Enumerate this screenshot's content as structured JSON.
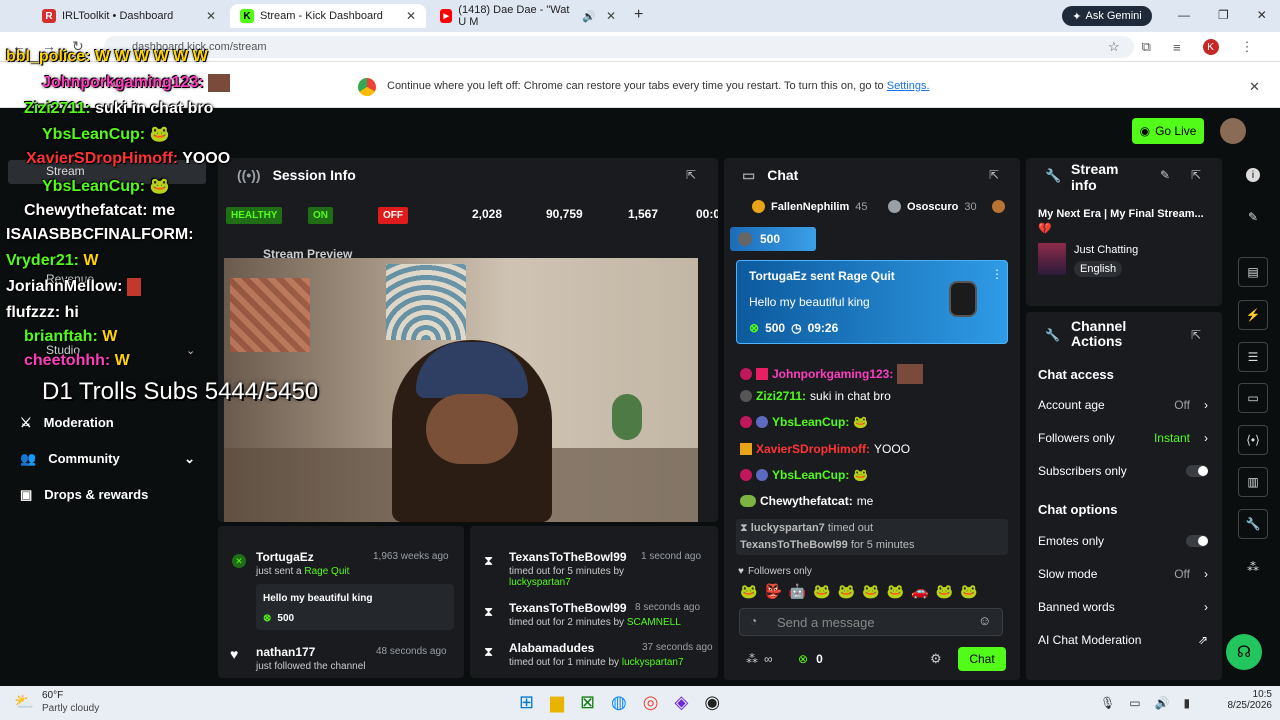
{
  "browser": {
    "tabs": [
      {
        "title": "IRLToolkit • Dashboard",
        "favicon": "R",
        "color": "#d42e2e"
      },
      {
        "title": "Stream - Kick Dashboard",
        "favicon": "K",
        "color": "#53fc18"
      },
      {
        "title": "(1418) Dae Dae - \"Wat U M",
        "favicon": "▶",
        "color": "#ff0000"
      }
    ],
    "ask_gemini": "Ask Gemini",
    "url": "dashboard.kick.com/stream",
    "restore_text": "Continue where you left off: Chrome can restore your tabs every time you restart. To turn this on, go to",
    "restore_link": "Settings."
  },
  "header": {
    "go_live": "Go Live"
  },
  "overlay": {
    "chat": [
      {
        "user": "bbl_police:",
        "msg": "W W W W W W",
        "color": "#ffd400"
      },
      {
        "user": "Johnporkgaming123:",
        "msg": "",
        "color": "#ff3ebf"
      },
      {
        "user": "Zizi2711:",
        "msg": "suki in chat bro",
        "color": "#53fc18"
      },
      {
        "user": "YbsLeanCup:",
        "msg": "",
        "color": "#53fc18"
      },
      {
        "user": "XavierSDropHimoff:",
        "msg": "YOOO",
        "color": "#ff3333"
      },
      {
        "user": "YbsLeanCup:",
        "msg": "",
        "color": "#53fc18"
      },
      {
        "user": "Chewythefatcat:",
        "msg": "me",
        "color": "#ffffff"
      },
      {
        "user": "ISAIASBBCFINALFORM:",
        "msg": "",
        "color": "#ffffff"
      },
      {
        "user": "Vryder21:",
        "msg": "W",
        "color": "#53fc18"
      },
      {
        "user": "JoriahnMellow:",
        "msg": "",
        "color": "#ffffff"
      },
      {
        "user": "flufzzz:",
        "msg": "hi",
        "color": "#ffffff"
      },
      {
        "user": "brianftah:",
        "msg": "W",
        "color": "#53fc18"
      },
      {
        "user": "cheetohhh:",
        "msg": "W",
        "color": "#ff3ebf"
      }
    ],
    "subs_goal": "D1 Trolls Subs 5444/5450"
  },
  "sidebar": {
    "items": [
      {
        "label": "Stream"
      },
      {
        "label": "Revenue"
      },
      {
        "label": "Studio"
      },
      {
        "label": "Moderation"
      },
      {
        "label": "Community"
      },
      {
        "label": "Drops & rewards"
      }
    ]
  },
  "session": {
    "title": "Session Info",
    "health": "HEALTHY",
    "on": "ON",
    "off": "OFF",
    "stats": [
      "2,028",
      "90,759",
      "1,567",
      "00:0"
    ],
    "preview_title": "Stream Preview"
  },
  "activity": {
    "left": [
      {
        "user": "TortugaEz",
        "time": "1,963 weeks ago",
        "action": "just sent a",
        "item": "Rage Quit",
        "message": "Hello my beautiful king",
        "amount": "500"
      },
      {
        "user": "nathan177",
        "time": "48 seconds ago",
        "action": "just followed the channel"
      }
    ],
    "right": [
      {
        "user": "TexansToTheBowl99",
        "time": "1 second ago",
        "action": "timed out for 5 minutes by",
        "by": "luckyspartan7"
      },
      {
        "user": "TexansToTheBowl99",
        "time": "8 seconds ago",
        "action": "timed out for 2 minutes by",
        "by": "SCAMNELL"
      },
      {
        "user": "Alabamadudes",
        "time": "37 seconds ago",
        "action": "timed out for 1 minute by",
        "by": "luckyspartan7"
      }
    ]
  },
  "chat": {
    "title": "Chat",
    "top_users": [
      {
        "name": "FallenNephilim",
        "count": "45"
      },
      {
        "name": "Ososcuro",
        "count": "30"
      }
    ],
    "pinned_amount": "500",
    "gift": {
      "header": "TortugaEz sent Rage Quit",
      "message": "Hello my beautiful king",
      "amount": "500",
      "time": "09:26"
    },
    "messages": [
      {
        "user": "Johnporkgaming123:",
        "msg": "",
        "color": "#ff3ebf"
      },
      {
        "user": "Zizi2711:",
        "msg": "suki in chat bro",
        "color": "#53fc18"
      },
      {
        "user": "YbsLeanCup:",
        "msg": "",
        "color": "#53fc18"
      },
      {
        "user": "XavierSDropHimoff:",
        "msg": "YOOO",
        "color": "#ff3333"
      },
      {
        "user": "YbsLeanCup:",
        "msg": "",
        "color": "#53fc18"
      },
      {
        "user": "Chewythefatcat:",
        "msg": "me",
        "color": "#ffffff"
      }
    ],
    "timeout_user": "luckyspartan7",
    "timeout_text": "timed out",
    "timeout_target": "TexansToTheBowl99",
    "timeout_duration": "for 5 minutes",
    "followers_only": "Followers only",
    "placeholder": "Send a message",
    "points": "0",
    "send": "Chat"
  },
  "stream_info": {
    "title": "Stream info",
    "stream_title": "My Next Era | My Final Stream... 💔",
    "category": "Just Chatting",
    "language": "English"
  },
  "channel_actions": {
    "title": "Channel Actions",
    "chat_access": "Chat access",
    "account_age": {
      "label": "Account age",
      "value": "Off"
    },
    "followers_only": {
      "label": "Followers only",
      "value": "Instant"
    },
    "subscribers_only": "Subscribers only",
    "chat_options": "Chat options",
    "emotes_only": "Emotes only",
    "slow_mode": {
      "label": "Slow mode",
      "value": "Off"
    },
    "banned_words": "Banned words",
    "ai_moderation": "AI Chat Moderation"
  },
  "taskbar": {
    "weather_temp": "60°F",
    "weather_desc": "Partly cloudy",
    "time": "10:5",
    "date": "8/25/2026"
  }
}
